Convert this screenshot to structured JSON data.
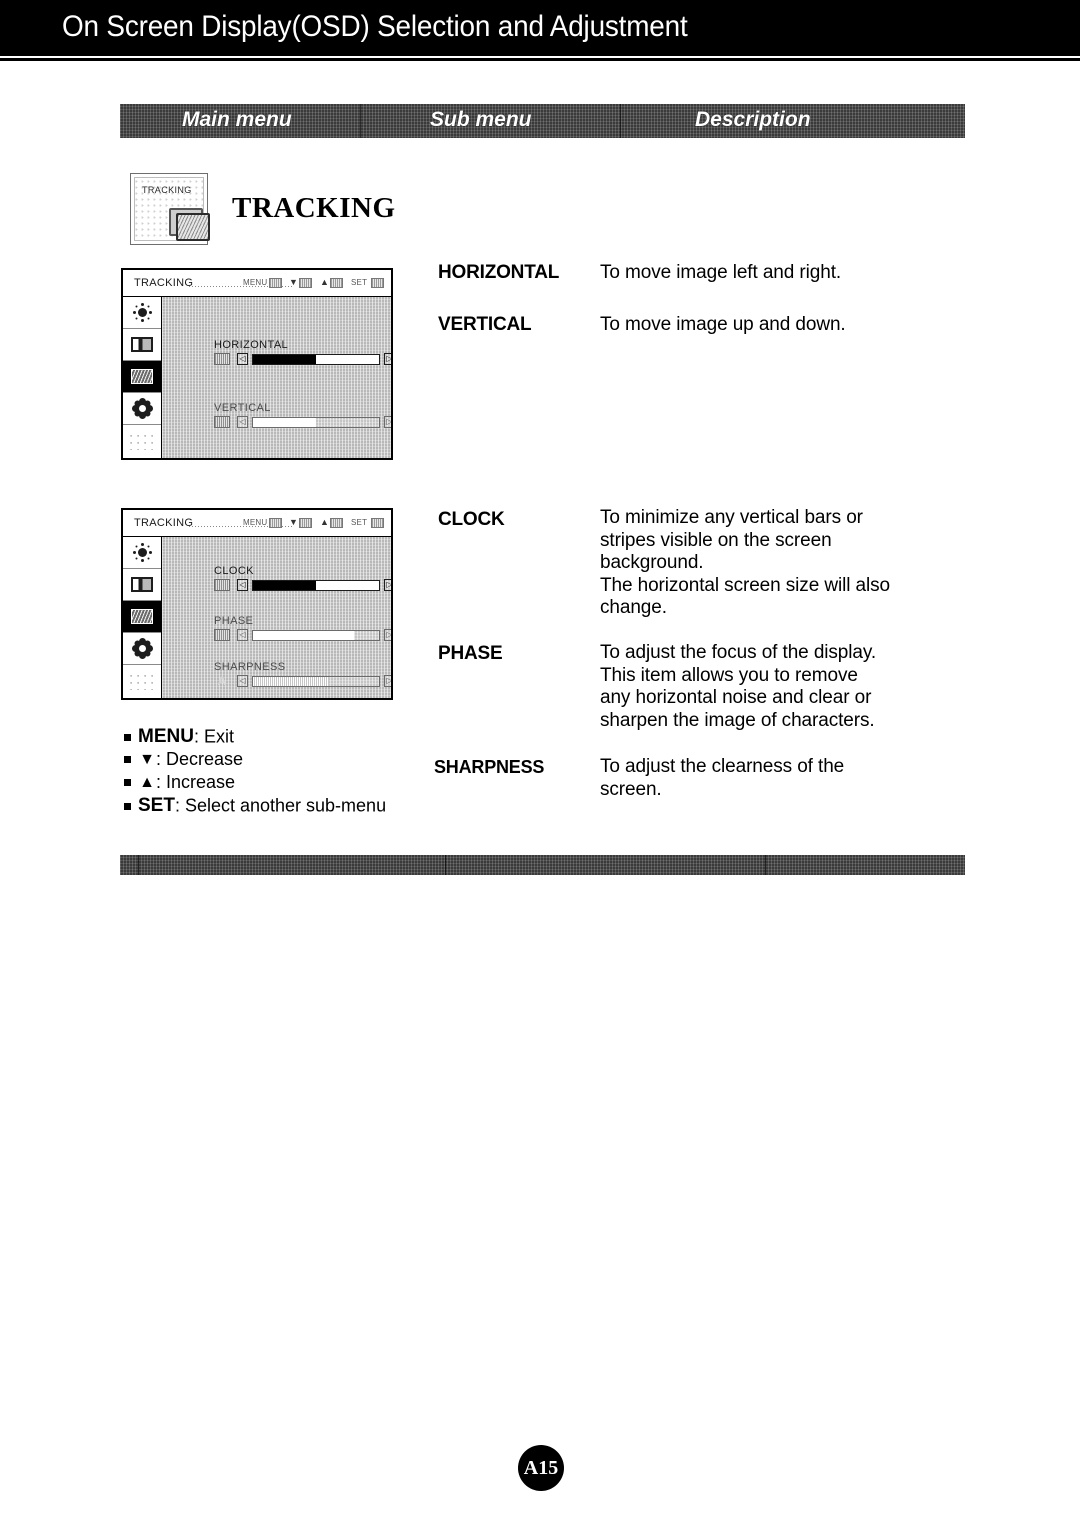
{
  "banner": {
    "title": "On Screen Display(OSD) Selection and Adjustment"
  },
  "table_header": {
    "main_menu": "Main menu",
    "sub_menu": "Sub menu",
    "description": "Description"
  },
  "main_menu": {
    "icon_label": "TRACKING",
    "title": "TRACKING"
  },
  "osd_common": {
    "title": "TRACKING",
    "menu_key": "MENU",
    "down_glyph": "▼",
    "up_glyph": "▲",
    "set_key": "SET",
    "left_cap": "◁",
    "right_cap": "▷"
  },
  "osd_tracking_position": {
    "rows": [
      {
        "label": "HORIZONTAL",
        "value": "50",
        "percent": 50,
        "active": true,
        "icon": "horizontal-position-icon"
      },
      {
        "label": "VERTICAL",
        "value": "50",
        "percent": 50,
        "active": false,
        "icon": "vertical-position-icon"
      }
    ]
  },
  "osd_tracking_clock": {
    "rows": [
      {
        "label": "CLOCK",
        "value": "50",
        "percent": 50,
        "active": true,
        "icon": "clock-icon"
      },
      {
        "label": "PHASE",
        "value": "80",
        "percent": 80,
        "active": false,
        "icon": "phase-icon"
      },
      {
        "label": "SHARPNESS",
        "value": "6",
        "percent": 60,
        "active": false,
        "icon": "sharpness-icon"
      }
    ]
  },
  "sidebar_icons": [
    "brightness-icon",
    "contrast-icon",
    "tracking-icon",
    "setup-icon",
    "blank-icon"
  ],
  "legend": [
    {
      "key": "MENU",
      "glyph": "",
      "text": ": Exit"
    },
    {
      "key": "",
      "glyph": "▼",
      "text": ": Decrease"
    },
    {
      "key": "",
      "glyph": "▲",
      "text": ": Increase"
    },
    {
      "key": "SET",
      "glyph": "",
      "text": ": Select another sub-menu"
    }
  ],
  "descriptions": [
    {
      "sub": "HORIZONTAL",
      "text": "To move image left and right."
    },
    {
      "sub": "VERTICAL",
      "text": "To move image up and down."
    },
    {
      "sub": "CLOCK",
      "text": "To minimize any vertical bars or\nstripes visible on the screen\nbackground.\nThe horizontal screen size will also\nchange."
    },
    {
      "sub": "PHASE",
      "text": "To adjust the focus of the display.\nThis item allows you to remove\nany horizontal noise and clear or\nsharpen the image of characters."
    },
    {
      "sub": "SHARPNESS",
      "text": "To adjust the clearness of the\nscreen."
    }
  ],
  "page_number": "A15"
}
